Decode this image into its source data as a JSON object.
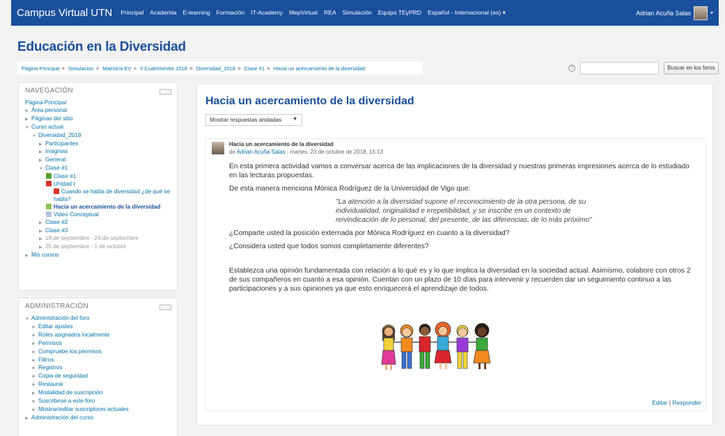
{
  "navbar": {
    "brand": "Campus Virtual UTN",
    "menu": [
      "Principal",
      "Academia",
      "E-learning",
      "Formación",
      "IT-Academy",
      "MepVirtual",
      "REA",
      "Simulación",
      "Equipo TEyPRD",
      "Español - Internacional (es)"
    ],
    "user_name": "Adrian Acuña Salas"
  },
  "header": {
    "title": "Educación en la Diversidad",
    "breadcrumb": [
      "Página Principal",
      "Simulacion",
      "Maestría EV",
      "II Cuatrimestre 2018",
      "Diversidad_2018",
      "Clase #1",
      "Hacia un acercamiento de la diversidad"
    ],
    "search_placeholder": "",
    "search_button": "Buscar en los foros"
  },
  "navigation": {
    "title": "NAVEGACIÓN",
    "items": [
      {
        "label": "Página Principal",
        "indent": 1,
        "glyph": "",
        "style": "link"
      },
      {
        "label": "Área personal",
        "indent": 1,
        "glyph": "■",
        "style": "link"
      },
      {
        "label": "Páginas del sitio",
        "indent": 1,
        "glyph": "▶",
        "style": "link"
      },
      {
        "label": "Curso actual",
        "indent": 1,
        "glyph": "▼",
        "style": "link"
      },
      {
        "label": "Diversidad_2018",
        "indent": 2,
        "glyph": "▼",
        "style": "link"
      },
      {
        "label": "Participantes",
        "indent": 3,
        "glyph": "▶",
        "style": "link"
      },
      {
        "label": "Insignias",
        "indent": 3,
        "glyph": "▶",
        "style": "link"
      },
      {
        "label": "General",
        "indent": 3,
        "glyph": "▶",
        "style": "link"
      },
      {
        "label": "Clase #1",
        "indent": 3,
        "glyph": "▼",
        "style": "link"
      },
      {
        "label": "Clase #1",
        "indent": 4,
        "icon": "#5aa02c",
        "style": "link"
      },
      {
        "label": "Unidad I",
        "indent": 4,
        "icon": "#d9342b",
        "style": "link"
      },
      {
        "label": "Cuando se habla de diversidad ¿de qué se habla?",
        "indent": 4,
        "icon": "#d9342b",
        "style": "link",
        "wrap": true
      },
      {
        "label": "Hacia un acercamiento de la diversidad",
        "indent": 4,
        "icon": "#8fbf5a",
        "style": "current"
      },
      {
        "label": "Video Conceptual",
        "indent": 4,
        "icon": "#b0c4de",
        "style": "link"
      },
      {
        "label": "Clase #2",
        "indent": 3,
        "glyph": "▶",
        "style": "link"
      },
      {
        "label": "Clase #3",
        "indent": 3,
        "glyph": "▶",
        "style": "link"
      },
      {
        "label": "18 de septiembre - 24 de septiembre",
        "indent": 3,
        "glyph": "▶",
        "style": "muted"
      },
      {
        "label": "25 de septiembre - 1 de octubre",
        "indent": 3,
        "glyph": "▶",
        "style": "muted"
      },
      {
        "label": "Mis cursos",
        "indent": 1,
        "glyph": "▶",
        "style": "link"
      }
    ]
  },
  "administration": {
    "title": "ADMINISTRACIÓN",
    "items": [
      {
        "label": "Administración del foro",
        "indent": 1,
        "glyph": "▼",
        "style": "link"
      },
      {
        "label": "Editar ajustes",
        "indent": 2,
        "glyph": "■",
        "style": "link"
      },
      {
        "label": "Roles asignados localmente",
        "indent": 2,
        "glyph": "■",
        "style": "link"
      },
      {
        "label": "Permisos",
        "indent": 2,
        "glyph": "■",
        "style": "link"
      },
      {
        "label": "Compruebe los permisos",
        "indent": 2,
        "glyph": "■",
        "style": "link"
      },
      {
        "label": "Filtros",
        "indent": 2,
        "glyph": "■",
        "style": "link"
      },
      {
        "label": "Registros",
        "indent": 2,
        "glyph": "■",
        "style": "link"
      },
      {
        "label": "Copia de seguridad",
        "indent": 2,
        "glyph": "■",
        "style": "link"
      },
      {
        "label": "Restaurar",
        "indent": 2,
        "glyph": "■",
        "style": "link"
      },
      {
        "label": "Modalidad de suscripción",
        "indent": 2,
        "glyph": "▶",
        "style": "link"
      },
      {
        "label": "Suscribirse a este foro",
        "indent": 2,
        "glyph": "■",
        "style": "link"
      },
      {
        "label": "Mostrar/editar suscriptores actuales",
        "indent": 2,
        "glyph": "■",
        "style": "link"
      },
      {
        "label": "Administración del curso",
        "indent": 1,
        "glyph": "▶",
        "style": "link"
      }
    ]
  },
  "discussion": {
    "title": "Hacia un acercamiento de la diversidad",
    "display_mode": "Mostrar respuestas anidadas",
    "post": {
      "subject": "Hacia un acercamiento de la diversidad",
      "by_prefix": "de",
      "author": "Adrian Acuña Salas",
      "date": " - martes, 23 de octubre de 2018, 15:13",
      "paragraph1": "En esta primera actividad vamos a conversar acerca de las implicaciones de la diversidad y nuestras primeras impresiones acerca de lo estudiado en las lecturas propuestas.",
      "paragraph2": "De esta manera menciona Mónica Rodríguez de la Universidad de Vigo que:",
      "quote": "\"La atención a la diversidad supone el reconocimiento de la otra persona, de su individualidad, originalidad e irrepetibilidad, y se inscribe en un contexto de reivindicación de lo personal, del presente, de las diferencias, de lo más próximo\"",
      "question1": "¿Comparte usted la posición externada por Mónica Rodríguez en cuanto a la diversidad?",
      "question2": "¿Considera usted que todos somos completamente diferentes?",
      "paragraph3": "Establezca una opinión fundamentada con relación a lo qué es y lo que implica la diversidad en la sociedad actual. Asimismo, colabore con otros 2 de sus compañeros en cuanto a esa opinión. Cuentan con un plazo de 10 días para intervenir y recuerden dar un seguimiento continuo a las participaciones y a sus opiniones ya que esto enriquecerá el aprendizaje de todos.",
      "edit_link": "Editar",
      "separator": " | ",
      "reply_link": "Responder"
    }
  },
  "colors": {
    "navbar": "#1a4f9c",
    "link": "#0070a8",
    "title": "#1a4f9c"
  }
}
